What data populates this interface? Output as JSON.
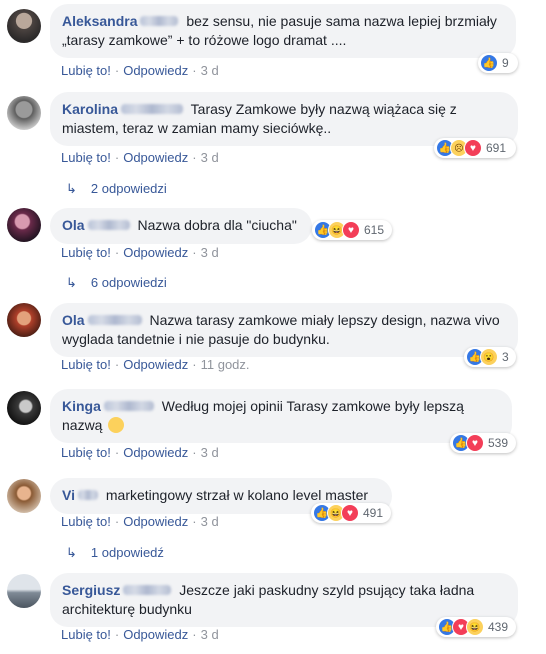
{
  "action_labels": {
    "like": "Lubię to!",
    "reply": "Odpowiedz"
  },
  "comments": [
    {
      "author_first": "Aleksandra",
      "text": "bez sensu, nie pasuje sama nazwa lepiej brzmiały „tarasy zamkowe” + to różowe logo dramat ....",
      "time": "3 d",
      "reactions": [
        "like"
      ],
      "reaction_count": "9"
    },
    {
      "author_first": "Karolina",
      "text": "Tarasy Zamkowe były nazwą wiążaca się z miastem, teraz w zamian mamy sieciówkę..",
      "time": "3 d",
      "reactions": [
        "like",
        "sad",
        "love"
      ],
      "reaction_count": "691",
      "replies": "2 odpowiedzi"
    },
    {
      "author_first": "Ola",
      "text": "Nazwa dobra dla \"ciucha\"",
      "time": "3 d",
      "reactions": [
        "like",
        "haha",
        "love"
      ],
      "reaction_count": "615",
      "replies": "6 odpowiedzi"
    },
    {
      "author_first": "Ola",
      "text": "Nazwa tarasy zamkowe miały lepszy design, nazwa vivo wyglada tandetnie i nie pasuje do budynku.",
      "time": "11 godz.",
      "reactions": [
        "like",
        "wow"
      ],
      "reaction_count": "3"
    },
    {
      "author_first": "Kinga",
      "text": "Według mojej opinii Tarasy zamkowe były lepszą nazwą",
      "time": "3 d",
      "reactions": [
        "like",
        "love"
      ],
      "reaction_count": "539"
    },
    {
      "author_first": "Vi",
      "text": "marketingowy strzał w kolano level master",
      "time": "3 d",
      "reactions": [
        "like",
        "haha",
        "love"
      ],
      "reaction_count": "491",
      "replies": "1 odpowiedź"
    },
    {
      "author_first": "Sergiusz",
      "text": "Jeszcze jaki paskudny szyld psujący taka ładna architekturę budynku",
      "time": "3 d",
      "reactions": [
        "like",
        "love",
        "haha"
      ],
      "reaction_count": "439"
    }
  ],
  "colors": {
    "link": "#385898",
    "bubble": "#f2f3f5",
    "like": "#3578e5",
    "love": "#f33e58"
  }
}
